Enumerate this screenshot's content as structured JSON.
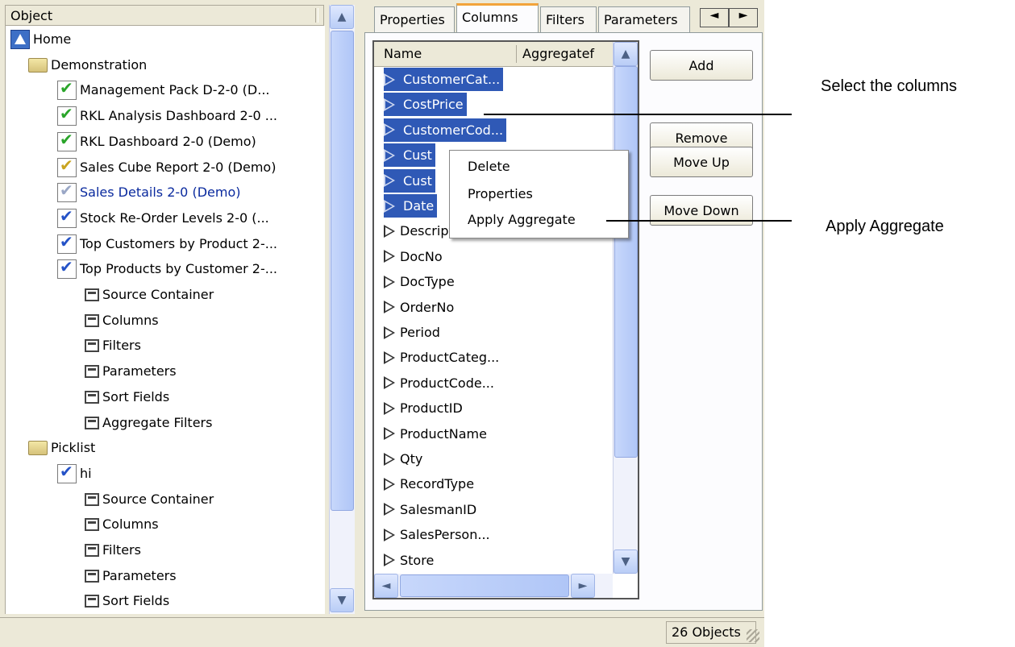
{
  "tree": {
    "header": "Object",
    "items": [
      {
        "label": "Home",
        "icon": "home-icon",
        "indent": 0
      },
      {
        "label": "Demonstration",
        "icon": "folder-icon",
        "indent": 1
      },
      {
        "label": "Management Pack D-2-0 (D...",
        "icon": "report-green-icon",
        "indent": 2
      },
      {
        "label": "RKL Analysis Dashboard 2-0 ...",
        "icon": "report-green-icon",
        "indent": 2
      },
      {
        "label": "RKL Dashboard 2-0 (Demo)",
        "icon": "report-green-icon",
        "indent": 2
      },
      {
        "label": "Sales Cube Report 2-0 (Demo)",
        "icon": "report-yellow-icon",
        "indent": 2
      },
      {
        "label": "Sales Details 2-0 (Demo)",
        "icon": "report-grey-icon",
        "indent": 2
      },
      {
        "label": "Stock Re-Order Levels 2-0 (...",
        "icon": "report-blue-icon",
        "indent": 2
      },
      {
        "label": "Top Customers by Product 2-...",
        "icon": "report-blue-icon",
        "indent": 2
      },
      {
        "label": "Top Products by Customer 2-...",
        "icon": "report-blue-icon",
        "indent": 2
      },
      {
        "label": "Source Container",
        "icon": "node-icon",
        "indent": 3
      },
      {
        "label": "Columns",
        "icon": "node-icon",
        "indent": 3
      },
      {
        "label": "Filters",
        "icon": "node-icon",
        "indent": 3
      },
      {
        "label": "Parameters",
        "icon": "node-icon",
        "indent": 3
      },
      {
        "label": "Sort Fields",
        "icon": "node-icon",
        "indent": 3
      },
      {
        "label": "Aggregate Filters",
        "icon": "node-icon",
        "indent": 3
      },
      {
        "label": "Picklist",
        "icon": "folder-icon",
        "indent": 1
      },
      {
        "label": "hi",
        "icon": "report-blue-icon",
        "indent": 2
      },
      {
        "label": "Source Container",
        "icon": "node-icon",
        "indent": 3
      },
      {
        "label": "Columns",
        "icon": "node-icon",
        "indent": 3
      },
      {
        "label": "Filters",
        "icon": "node-icon",
        "indent": 3
      },
      {
        "label": "Parameters",
        "icon": "node-icon",
        "indent": 3
      },
      {
        "label": "Sort Fields",
        "icon": "node-icon",
        "indent": 3
      }
    ]
  },
  "tabs": [
    "Properties",
    "Columns",
    "Filters",
    "Parameters"
  ],
  "active_tab": "Columns",
  "tab_scroll": {
    "left": "◄",
    "right": "►"
  },
  "columns_list": {
    "headers": [
      "Name",
      "Aggregatef"
    ],
    "rows": [
      {
        "label": "CustomerCat...",
        "selected": true
      },
      {
        "label": "CostPrice",
        "selected": true
      },
      {
        "label": "CustomerCod...",
        "selected": true
      },
      {
        "label": "Cust",
        "selected": true
      },
      {
        "label": "Cust",
        "selected": true
      },
      {
        "label": "Date",
        "selected": true
      },
      {
        "label": "Description",
        "selected": false
      },
      {
        "label": "DocNo",
        "selected": false
      },
      {
        "label": "DocType",
        "selected": false
      },
      {
        "label": "OrderNo",
        "selected": false
      },
      {
        "label": "Period",
        "selected": false
      },
      {
        "label": "ProductCateg...",
        "selected": false
      },
      {
        "label": "ProductCode...",
        "selected": false
      },
      {
        "label": "ProductID",
        "selected": false
      },
      {
        "label": "ProductName",
        "selected": false
      },
      {
        "label": "Qty",
        "selected": false
      },
      {
        "label": "RecordType",
        "selected": false
      },
      {
        "label": "SalesmanID",
        "selected": false
      },
      {
        "label": "SalesPerson...",
        "selected": false
      },
      {
        "label": "Store",
        "selected": false
      }
    ]
  },
  "buttons": {
    "add": "Add",
    "remove": "Remove",
    "move_up": "Move Up",
    "move_down": "Move Down"
  },
  "context_menu": [
    "Delete",
    "Properties",
    "Apply Aggregate"
  ],
  "status": {
    "count": "26 Objects"
  },
  "annotations": {
    "select_columns": "Select the columns",
    "apply_aggregate": "Apply Aggregate"
  },
  "colors": {
    "selection": "#2f59b6",
    "active_tab_accent": "#f2a33a",
    "window_bg": "#ece9d8"
  }
}
